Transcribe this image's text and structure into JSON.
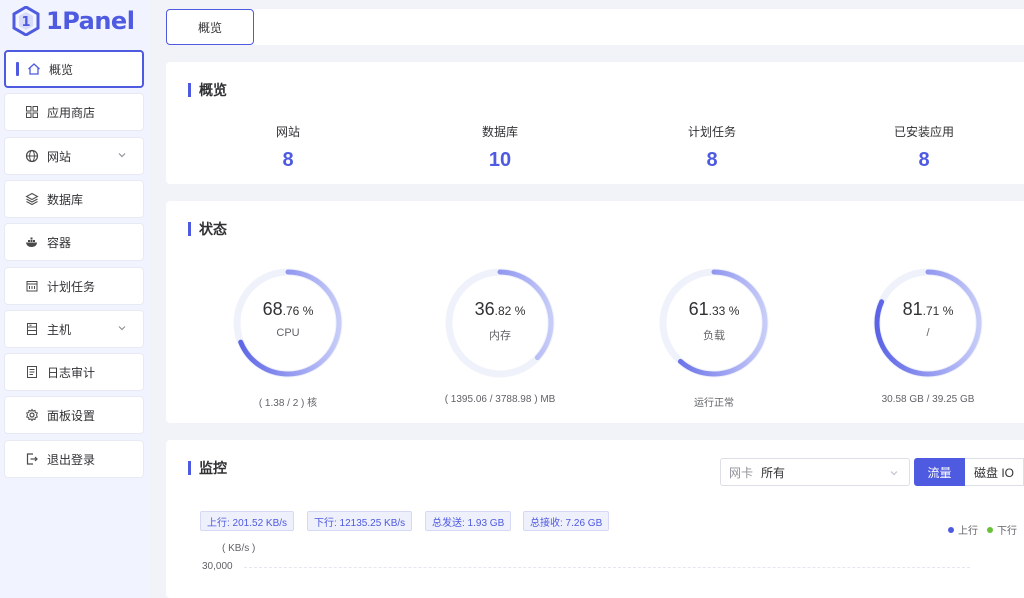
{
  "app": {
    "logo_text": "1Panel"
  },
  "sidebar": {
    "items": [
      {
        "label": "概览",
        "icon": "home-icon",
        "active": true
      },
      {
        "label": "应用商店",
        "icon": "grid-icon"
      },
      {
        "label": "网站",
        "icon": "globe-icon",
        "expandable": true
      },
      {
        "label": "数据库",
        "icon": "layers-icon"
      },
      {
        "label": "容器",
        "icon": "docker-icon"
      },
      {
        "label": "计划任务",
        "icon": "calendar-icon"
      },
      {
        "label": "主机",
        "icon": "server-icon",
        "expandable": true
      },
      {
        "label": "日志审计",
        "icon": "log-icon"
      },
      {
        "label": "面板设置",
        "icon": "gear-icon"
      },
      {
        "label": "退出登录",
        "icon": "logout-icon"
      }
    ]
  },
  "tabs": [
    {
      "label": "概览"
    }
  ],
  "overview": {
    "title": "概览",
    "stats": [
      {
        "label": "网站",
        "value": "8"
      },
      {
        "label": "数据库",
        "value": "10"
      },
      {
        "label": "计划任务",
        "value": "8"
      },
      {
        "label": "已安装应用",
        "value": "8"
      }
    ]
  },
  "status": {
    "title": "状态",
    "gauges": [
      {
        "int": "68",
        "dec": ".76",
        "unit": "%",
        "name": "CPU",
        "sub": "( 1.38 / 2 ) 核",
        "percent": 68.76
      },
      {
        "int": "36",
        "dec": ".82",
        "unit": "%",
        "name": "内存",
        "sub": "( 1395.06 / 3788.98 ) MB",
        "percent": 36.82
      },
      {
        "int": "61",
        "dec": ".33",
        "unit": "%",
        "name": "负载",
        "sub": "运行正常",
        "percent": 61.33
      },
      {
        "int": "81",
        "dec": ".71",
        "unit": "%",
        "name": "/",
        "sub": "30.58 GB / 39.25 GB",
        "percent": 81.71
      }
    ]
  },
  "monitor": {
    "title": "监控",
    "nic_prefix": "网卡",
    "nic_value": "所有",
    "btn_traffic": "流量",
    "btn_disk": "磁盘 IO",
    "chips": [
      "上行: 201.52 KB/s",
      "下行: 12135.25 KB/s",
      "总发送: 1.93 GB",
      "总接收: 7.26 GB"
    ],
    "legend_up": "上行",
    "legend_down": "下行",
    "unit": "( KB/s )",
    "y_tick": "30,000"
  },
  "colors": {
    "accent": "#4e5ae0",
    "legend_up": "#4e5ae0",
    "legend_down": "#67c23a"
  }
}
